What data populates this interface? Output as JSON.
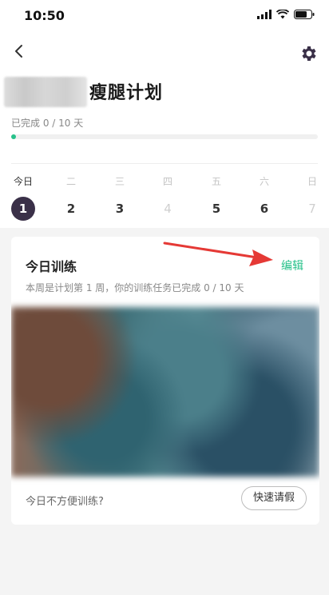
{
  "status_bar": {
    "time": "10:50"
  },
  "plan": {
    "title": "瘦腿计划",
    "progress_text": "已完成 0 / 10 天",
    "progress_fraction": 0
  },
  "week": {
    "days": [
      "今日",
      "二",
      "三",
      "四",
      "五",
      "六",
      "日"
    ],
    "dates": [
      "1",
      "2",
      "3",
      "4",
      "5",
      "6",
      "7"
    ],
    "active_index": 0,
    "muted_indices": [
      3,
      6
    ]
  },
  "card": {
    "title": "今日训练",
    "edit_label": "编辑",
    "subtitle": "本周是计划第 1 周，你的训练任务已完成 0 / 10 天",
    "footer_text": "今日不方便训练?",
    "leave_button_label": "快速请假"
  },
  "icons": {
    "back": "chevron-left-icon",
    "settings": "gear-icon",
    "annotation": "red-arrow-icon"
  },
  "colors": {
    "accent": "#27c18a",
    "active_date_bg": "#3a3048",
    "annotation_red": "#e53935"
  }
}
